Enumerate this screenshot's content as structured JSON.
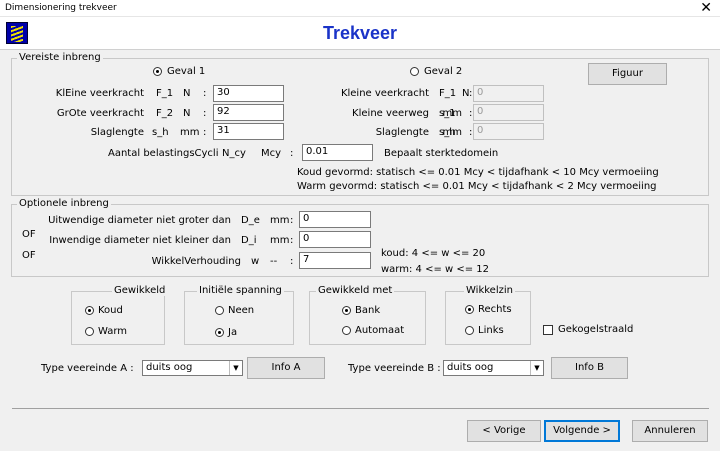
{
  "window": {
    "title": "Dimensionering trekveer",
    "close_glyph": "✕"
  },
  "app": {
    "title": "Trekveer",
    "logo_icon": "spring-logo-icon"
  },
  "required": {
    "legend": "Vereiste inbreng",
    "geval1_label": "Geval 1",
    "geval2_label": "Geval 2",
    "geval_selected": "Geval 1",
    "figuur_button": "Figuur",
    "left": {
      "f1_label": "KlEine veerkracht",
      "f1_sym": "F_1",
      "f1_unit": "N",
      "f1_colon": ":",
      "f1_value": "30",
      "f2_label": "GrOte veerkracht",
      "f2_sym": "F_2",
      "f2_unit": "N",
      "f2_colon": ":",
      "f2_value": "92",
      "sh_label": "Slaglengte",
      "sh_sym": "s_h",
      "sh_unit": "mm",
      "sh_colon": ":",
      "sh_value": "31"
    },
    "right": {
      "f1_label": "Kleine veerkracht",
      "f1_sym": "F_1",
      "f1_unit": "N",
      "f1_colon": ":",
      "f1_value": "0",
      "s1_label": "Kleine veerweg",
      "s1_sym": "s_1",
      "s1_unit": "mm",
      "s1_colon": ":",
      "s1_value": "0",
      "sh_label": "Slaglengte",
      "sh_sym": "s_h",
      "sh_unit": "mm",
      "sh_colon": ":",
      "sh_value": "0"
    },
    "cycli_label": "Aantal belastingsCycli",
    "cycli_sym": "N_cy",
    "cycli_unit": "Mcy",
    "cycli_colon": ":",
    "cycli_value": "0.01",
    "cycli_note": "Bepaalt sterktedomein",
    "koud_note": "Koud gevormd: statisch <= 0.01 Mcy < tijdafhank < 10 Mcy vermoeiing",
    "warm_note": "Warm gevormd: statisch <= 0.01 Mcy < tijdafhank <  2 Mcy vermoeiing"
  },
  "optional": {
    "legend": "Optionele inbreng",
    "of1": "OF",
    "of2": "OF",
    "de_label": "Uitwendige diameter niet groter dan",
    "de_sym": "D_e",
    "de_unit": "mm",
    "de_colon": ":",
    "de_value": "0",
    "di_label": "Inwendige diameter niet kleiner dan",
    "di_sym": "D_i",
    "di_unit": "mm",
    "di_colon": ":",
    "di_value": "0",
    "w_label": "WikkelVerhouding",
    "w_sym": "w",
    "w_unit": "--",
    "w_colon": ":",
    "w_value": "7",
    "koud_range": "koud:  4 <= w <= 20",
    "warm_range": "warm:  4 <= w <= 12"
  },
  "gewikkeld": {
    "legend": "Gewikkeld",
    "opt1": "Koud",
    "opt2": "Warm",
    "selected": "Koud"
  },
  "spanning": {
    "legend": "Initiële spanning",
    "opt1": "Neen",
    "opt2": "Ja",
    "selected": "Ja"
  },
  "gewikkeld_met": {
    "legend": "Gewikkeld met",
    "opt1": "Bank",
    "opt2": "Automaat",
    "selected": "Bank"
  },
  "wikkelzin": {
    "legend": "Wikkelzin",
    "opt1": "Rechts",
    "opt2": "Links",
    "selected": "Rechts"
  },
  "gekogelstraald": {
    "label": "Gekogelstraald",
    "checked": false
  },
  "type_a": {
    "label": "Type veereinde  A :",
    "value": "duits oog",
    "info_button": "Info A"
  },
  "type_b": {
    "label": "Type veereinde B :",
    "value": "duits oog",
    "info_button": "Info B"
  },
  "footer": {
    "prev": "< Vorige",
    "next": "Volgende >",
    "cancel": "Annuleren"
  }
}
